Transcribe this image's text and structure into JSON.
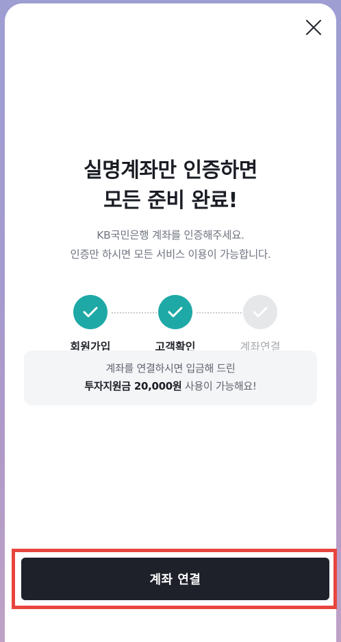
{
  "header": {
    "close_icon": "close-icon"
  },
  "title": {
    "line1": "실명계좌만 인증하면",
    "line2": "모든 준비 완료!"
  },
  "subtitle": {
    "line1": "KB국민은행 계좌를 인증해주세요.",
    "line2": "인증만 하시면 모든 서비스 이용이 가능합니다."
  },
  "steps": [
    {
      "label": "회원가입",
      "status": "done",
      "icon": "check-icon"
    },
    {
      "label": "고객확인",
      "status": "done",
      "icon": "check-icon"
    },
    {
      "label": "계좌연결",
      "status": "pending",
      "icon": "check-icon"
    }
  ],
  "info": {
    "line1": "계좌를 연결하시면 입금해 드린",
    "line2_strong": "투자지원금 20,000원",
    "line2_rest": " 사용이 가능해요!"
  },
  "cta": {
    "label": "계좌 연결"
  },
  "colors": {
    "accent_teal": "#1fa9a6",
    "button_dark": "#1e202a",
    "highlight_red": "#e8453d"
  }
}
